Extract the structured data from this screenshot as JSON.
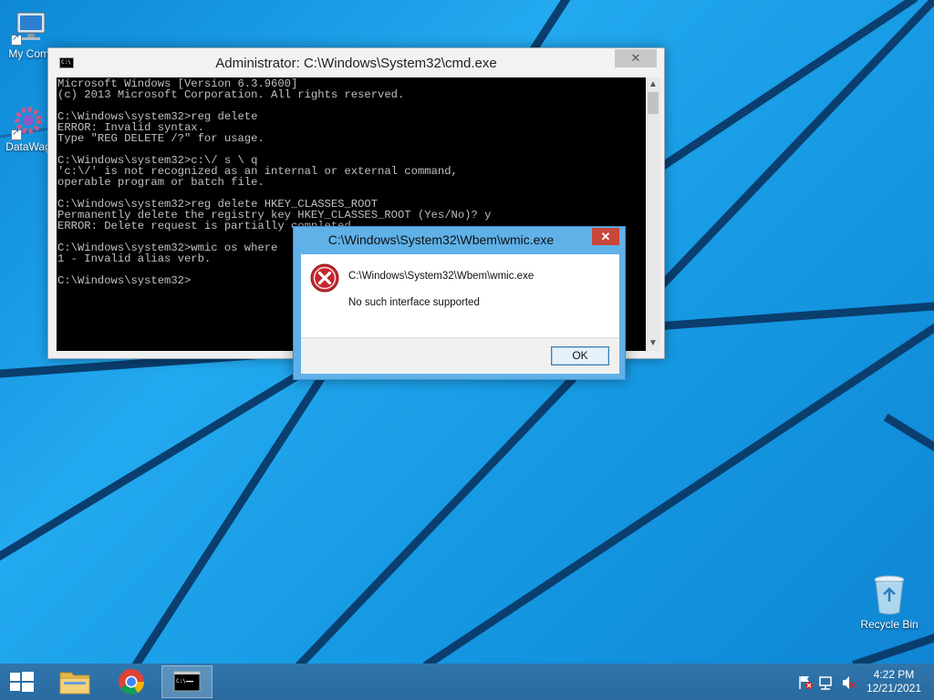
{
  "desktop": {
    "icons": [
      {
        "label": "My Comp",
        "icon": "computer-icon"
      },
      {
        "label": "DataWag",
        "icon": "gear-icon"
      },
      {
        "label": "Recycle Bin",
        "icon": "recycle-bin-icon"
      }
    ]
  },
  "cmd_window": {
    "title": "Administrator: C:\\Windows\\System32\\cmd.exe",
    "lines": [
      "Microsoft Windows [Version 6.3.9600]",
      "(c) 2013 Microsoft Corporation. All rights reserved.",
      "",
      "C:\\Windows\\system32>reg delete",
      "ERROR: Invalid syntax.",
      "Type \"REG DELETE /?\" for usage.",
      "",
      "C:\\Windows\\system32>c:\\/ s \\ q",
      "'c:\\/' is not recognized as an internal or external command,",
      "operable program or batch file.",
      "",
      "C:\\Windows\\system32>reg delete HKEY_CLASSES_ROOT",
      "Permanently delete the registry key HKEY_CLASSES_ROOT (Yes/No)? y",
      "ERROR: Delete request is partially completed.",
      "",
      "C:\\Windows\\system32>wmic os where",
      "1 - Invalid alias verb.",
      "",
      "C:\\Windows\\system32>"
    ],
    "close_symbol": "✕"
  },
  "dialog": {
    "title": "C:\\Windows\\System32\\Wbem\\wmic.exe",
    "path": "C:\\Windows\\System32\\Wbem\\wmic.exe",
    "message": "No such interface supported",
    "ok_label": "OK",
    "close_symbol": "✕"
  },
  "taskbar": {
    "apps": [
      {
        "name": "start",
        "icon": "windows-start-icon"
      },
      {
        "name": "file-explorer",
        "icon": "folder-icon"
      },
      {
        "name": "chrome",
        "icon": "chrome-icon"
      },
      {
        "name": "command-prompt",
        "icon": "cmd-icon",
        "active": true
      }
    ],
    "clock": {
      "time": "4:22 PM",
      "date": "12/21/2021"
    }
  },
  "colors": {
    "wallpaper": "#1fa3e6",
    "taskbar": "#2c6fa6",
    "dialog_frame": "#5fb1e8",
    "close_red": "#c9473b"
  }
}
